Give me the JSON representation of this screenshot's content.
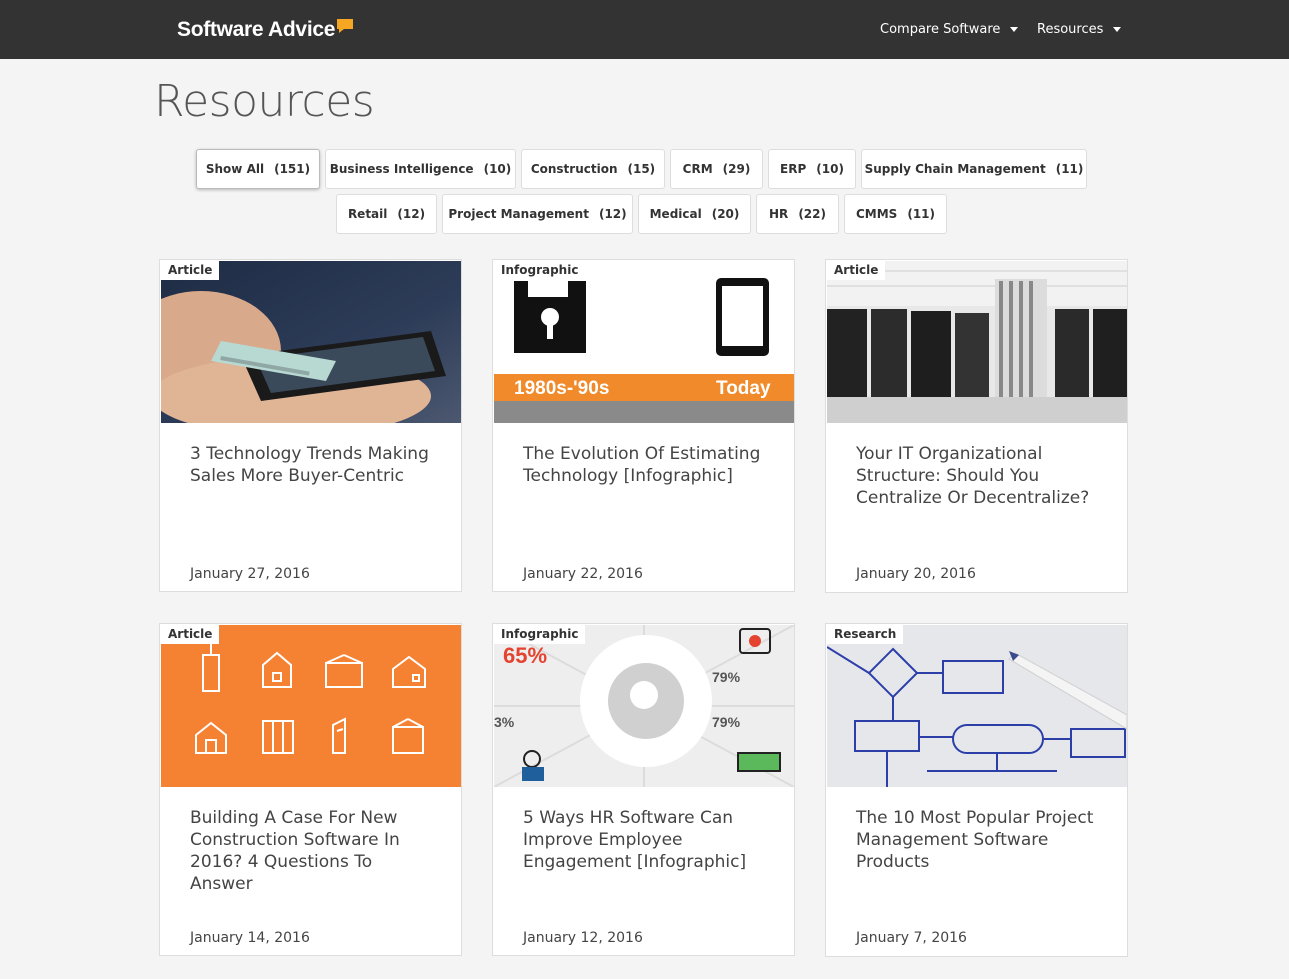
{
  "header": {
    "logo_text": "Software Advice",
    "nav": [
      {
        "label": "Compare Software"
      },
      {
        "label": "Resources"
      }
    ]
  },
  "page": {
    "title": "Resources"
  },
  "filters": [
    {
      "label": "Show All",
      "count": "(151)",
      "active": true
    },
    {
      "label": "Business Intelligence",
      "count": "(10)"
    },
    {
      "label": "Construction",
      "count": "(15)"
    },
    {
      "label": "CRM",
      "count": "(29)"
    },
    {
      "label": "ERP",
      "count": "(10)"
    },
    {
      "label": "Supply Chain Management",
      "count": "(11)"
    },
    {
      "label": "Retail",
      "count": "(12)"
    },
    {
      "label": "Project Management",
      "count": "(12)"
    },
    {
      "label": "Medical",
      "count": "(20)"
    },
    {
      "label": "HR",
      "count": "(22)"
    },
    {
      "label": "CMMS",
      "count": "(11)"
    }
  ],
  "cards": [
    {
      "tag": "Article",
      "title": "3 Technology Trends Making Sales More Buyer-Centric",
      "date": "January 27, 2016"
    },
    {
      "tag": "Infographic",
      "title": "The Evolution Of Estimating Technology [Infographic]",
      "date": "January 22, 2016",
      "img_text_left": "1980s-'90s",
      "img_text_right": "Today"
    },
    {
      "tag": "Article",
      "title": "Your IT Organizational Structure: Should You Centralize Or Decentralize?",
      "date": "January 20, 2016"
    },
    {
      "tag": "Article",
      "title": "Building A Case For New Construction Software In 2016? 4 Questions To Answer",
      "date": "January 14, 2016"
    },
    {
      "tag": "Infographic",
      "title": "5 Ways HR Software Can Improve Employee Engagement [Infographic]",
      "date": "January 12, 2016",
      "img_stat_1": "65%",
      "img_stat_2": "79%",
      "img_stat_3": "79%",
      "img_stat_4": "3%"
    },
    {
      "tag": "Research",
      "title": "The 10 Most Popular Project Management Software Products",
      "date": "January 7, 2016"
    }
  ],
  "colors": {
    "topbar": "#333333",
    "accent_orange": "#f5a623",
    "construction_orange": "#f58232"
  }
}
